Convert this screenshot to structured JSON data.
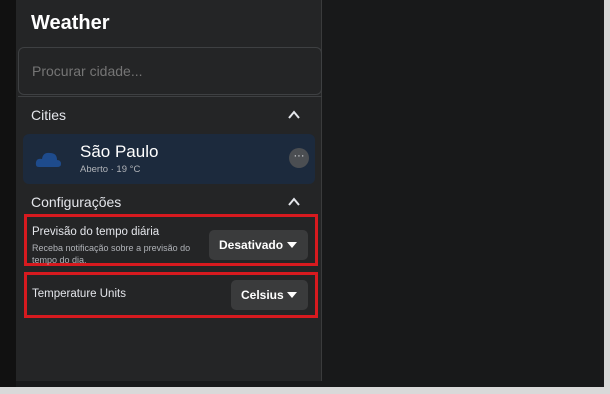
{
  "app": {
    "title": "Weather"
  },
  "search": {
    "placeholder": "Procurar cidade..."
  },
  "cities": {
    "header": "Cities",
    "items": [
      {
        "name": "São Paulo",
        "subtitle": "Aberto · 19 °C",
        "more_label": "···"
      }
    ]
  },
  "settings": {
    "header": "Configurações",
    "daily_forecast": {
      "title": "Previsão do tempo diária",
      "description": "Receba notificação sobre a previsão do tempo do dia.",
      "value": "Desativado"
    },
    "temperature_units": {
      "title": "Temperature Units",
      "value": "Celsius"
    }
  },
  "colors": {
    "highlight": "#d71a1f",
    "sidebar_bg": "#242526",
    "city_card_bg": "#1c2a3d"
  }
}
